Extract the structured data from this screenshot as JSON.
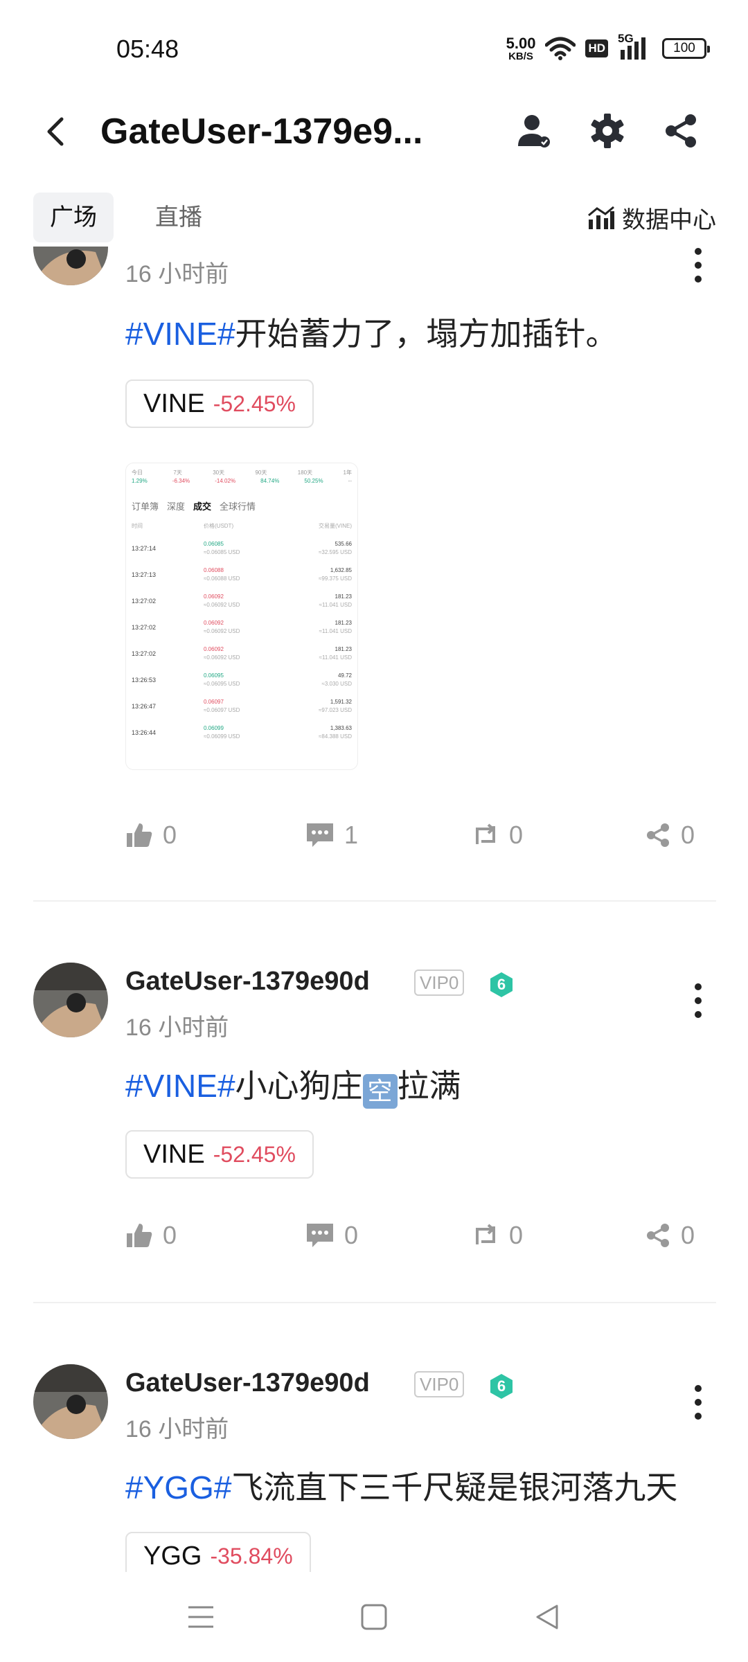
{
  "status": {
    "time": "05:48",
    "net_speed_value": "5.00",
    "net_speed_unit": "KB/S",
    "hd_label": "HD",
    "network_label": "5G",
    "battery": "100"
  },
  "header": {
    "title": "GateUser-1379e9...",
    "icons": [
      "back-icon",
      "user-icon",
      "gear-icon",
      "share-icon"
    ]
  },
  "tabs": {
    "items": [
      {
        "label": "广场",
        "active": true
      },
      {
        "label": "直播",
        "active": false
      }
    ],
    "data_center_label": "数据中心"
  },
  "posts": [
    {
      "time": "16 小时前",
      "text_hashtag": "#VINE#",
      "text_rest": "开始蓄力了，塌方加插针。",
      "coin": {
        "name": "VINE",
        "change": "-52.45%"
      },
      "actions": {
        "likes": "0",
        "comments": "1",
        "reposts": "0",
        "shares": "0"
      },
      "image": {
        "top_headers": [
          "今日",
          "7天",
          "30天",
          "90天",
          "180天",
          "1年"
        ],
        "top_values": [
          "1.29%",
          "-6.34%",
          "-14.02%",
          "84.74%",
          "50.25%",
          "--"
        ],
        "tabs": [
          "订单簿",
          "深度",
          "成交",
          "全球行情"
        ],
        "columns": [
          "时间",
          "价格(USDT)",
          "交易量(VINE)"
        ],
        "rows": [
          {
            "time": "13:27:14",
            "price": "0.06085",
            "price_usd": "≈0.06085 USD",
            "amount": "535.66",
            "amount_usd": "≈32.595 USD",
            "up": true
          },
          {
            "time": "13:27:13",
            "price": "0.06088",
            "price_usd": "≈0.06088 USD",
            "amount": "1,632.85",
            "amount_usd": "≈99.375 USD",
            "up": false
          },
          {
            "time": "13:27:02",
            "price": "0.06092",
            "price_usd": "≈0.06092 USD",
            "amount": "181.23",
            "amount_usd": "≈11.041 USD",
            "up": false
          },
          {
            "time": "13:27:02",
            "price": "0.06092",
            "price_usd": "≈0.06092 USD",
            "amount": "181.23",
            "amount_usd": "≈11.041 USD",
            "up": false
          },
          {
            "time": "13:27:02",
            "price": "0.06092",
            "price_usd": "≈0.06092 USD",
            "amount": "181.23",
            "amount_usd": "≈11.041 USD",
            "up": false
          },
          {
            "time": "13:26:53",
            "price": "0.06095",
            "price_usd": "≈0.06095 USD",
            "amount": "49.72",
            "amount_usd": "≈3.030 USD",
            "up": true
          },
          {
            "time": "13:26:47",
            "price": "0.06097",
            "price_usd": "≈0.06097 USD",
            "amount": "1,591.32",
            "amount_usd": "≈97.023 USD",
            "up": false
          },
          {
            "time": "13:26:44",
            "price": "0.06099",
            "price_usd": "≈0.06099 USD",
            "amount": "1,383.63",
            "amount_usd": "≈84.388 USD",
            "up": true
          }
        ]
      }
    },
    {
      "username": "GateUser-1379e90d",
      "vip": "VIP0",
      "level": "6",
      "time": "16 小时前",
      "text_hashtag": "#VINE#",
      "text_pre": "小心狗庄",
      "text_emoji": "空",
      "text_post": "拉满",
      "coin": {
        "name": "VINE",
        "change": "-52.45%"
      },
      "actions": {
        "likes": "0",
        "comments": "0",
        "reposts": "0",
        "shares": "0"
      }
    },
    {
      "username": "GateUser-1379e90d",
      "vip": "VIP0",
      "level": "6",
      "time": "16 小时前",
      "text_hashtag": "#YGG#",
      "text_rest": "飞流直下三千尺疑是银河落九天",
      "coin": {
        "name": "YGG",
        "change": "-35.84%"
      }
    }
  ],
  "colors": {
    "hashtag": "#1a5fe0",
    "negative": "#e04c5f",
    "positive": "#22a884",
    "level_badge": "#2ec4a5"
  },
  "navbar": {
    "icons": [
      "menu-icon",
      "home-square-icon",
      "back-triangle-icon"
    ]
  }
}
